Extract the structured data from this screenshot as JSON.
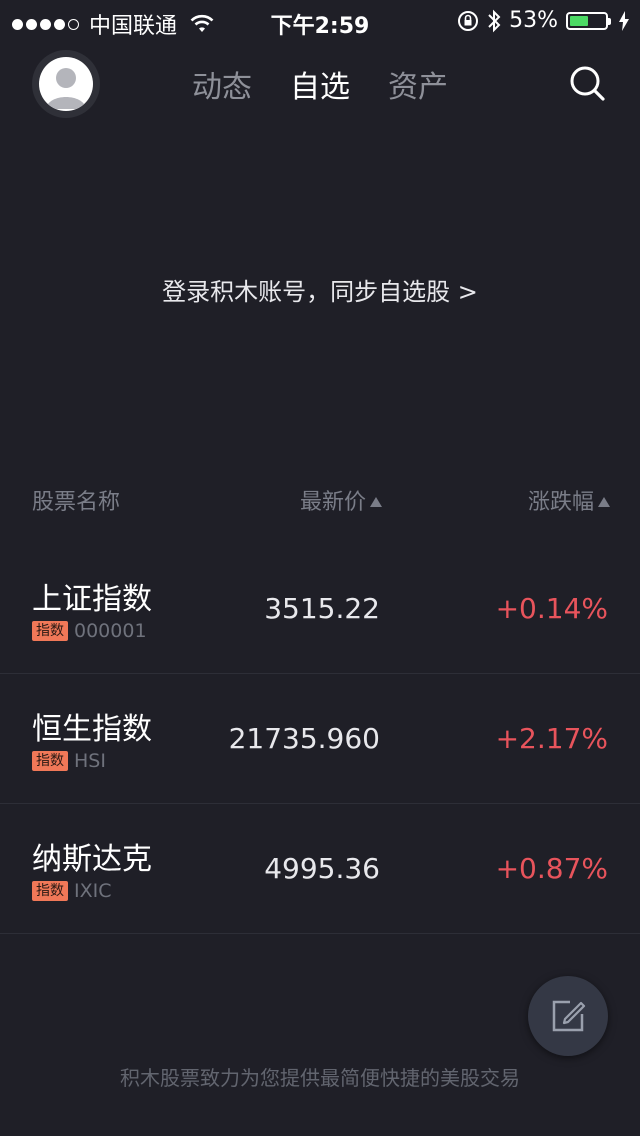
{
  "status_bar": {
    "carrier": "中国联通",
    "time": "下午2:59",
    "battery_percent": "53%",
    "battery_level": 0.53,
    "signal_bars": 4,
    "signal_max": 5
  },
  "nav": {
    "tabs": [
      {
        "label": "动态",
        "active": false
      },
      {
        "label": "自选",
        "active": true
      },
      {
        "label": "资产",
        "active": false
      }
    ]
  },
  "login_prompt": "登录积木账号，同步自选股 >",
  "table": {
    "headers": {
      "name": "股票名称",
      "price": "最新价",
      "change": "涨跌幅"
    },
    "rows": [
      {
        "name": "上证指数",
        "tag": "指数",
        "code": "000001",
        "price": "3515.22",
        "change": "+0.14%"
      },
      {
        "name": "恒生指数",
        "tag": "指数",
        "code": "HSI",
        "price": "21735.960",
        "change": "+2.17%"
      },
      {
        "name": "纳斯达克",
        "tag": "指数",
        "code": "IXIC",
        "price": "4995.36",
        "change": "+0.87%"
      }
    ]
  },
  "footer": "积木股票致力为您提供最简便快捷的美股交易",
  "colors": {
    "background": "#1f1f27",
    "rise": "#e8545c",
    "tag": "#f07858",
    "battery": "#4cd964"
  },
  "icons": {
    "search": "search-icon",
    "edit": "edit-icon",
    "wifi": "wifi-icon",
    "bluetooth": "bluetooth-icon",
    "rotation_lock": "rotation-lock-icon",
    "charging": "charging-bolt-icon"
  }
}
